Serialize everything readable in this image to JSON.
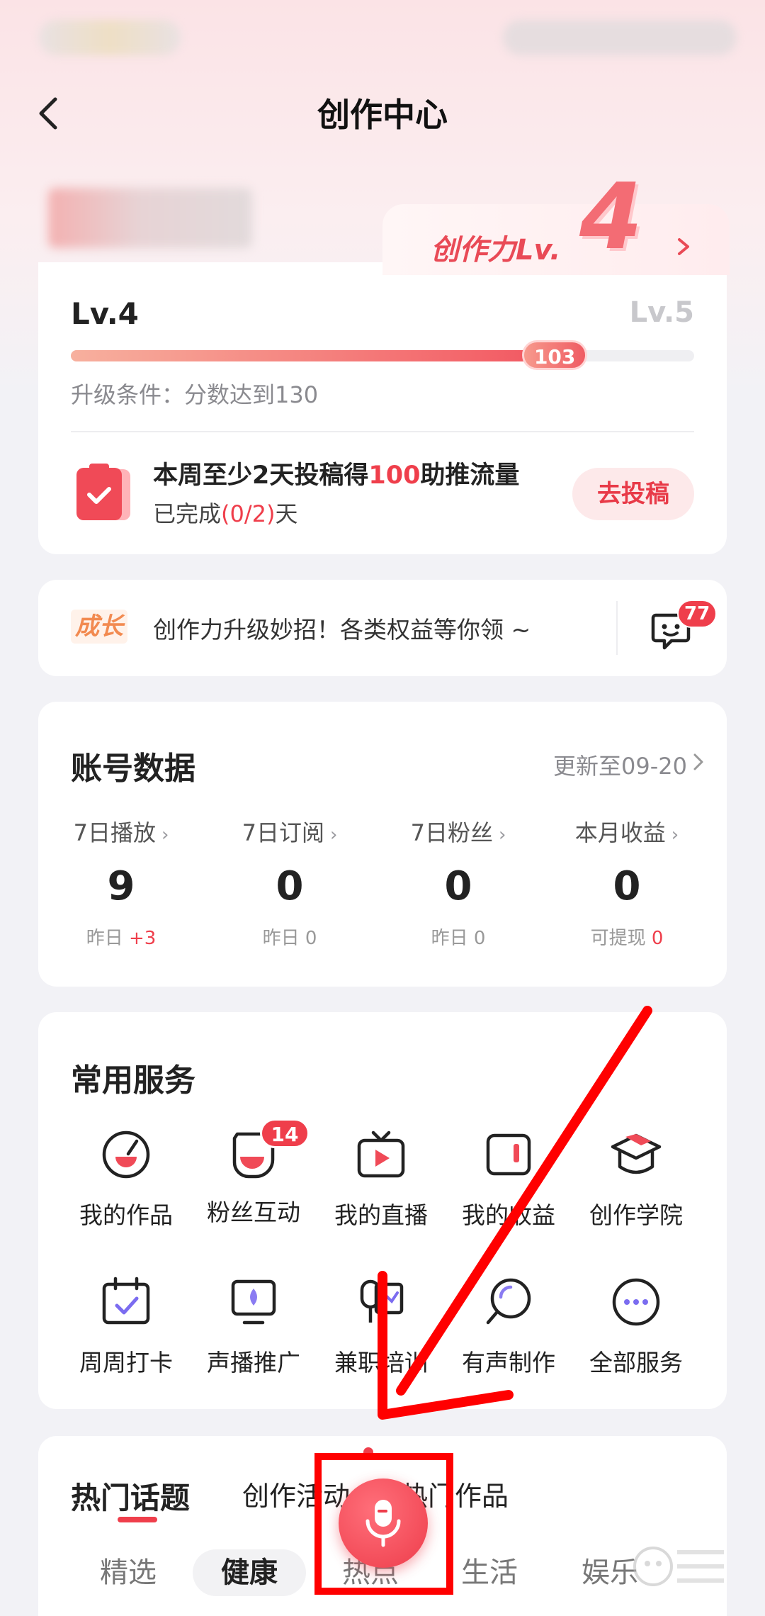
{
  "header": {
    "title": "创作中心"
  },
  "level_tab": {
    "label": "创作力Lv.",
    "level": "4"
  },
  "level_card": {
    "current_level": "Lv.4",
    "next_level": "Lv.5",
    "progress_score": "103",
    "progress_fraction": 0.792,
    "upgrade_condition": "升级条件：分数达到130",
    "task": {
      "title_prefix": "本周至少2天投稿得",
      "title_highlight": "100",
      "title_suffix": "助推流量",
      "sub_prefix": "已完成",
      "sub_highlight": "(0/2)",
      "sub_suffix": "天",
      "button": "去投稿"
    }
  },
  "growth_bar": {
    "badge": "成长",
    "text": "创作力升级妙招！各类权益等你领 ~",
    "message_count": "77"
  },
  "account_data": {
    "title": "账号数据",
    "updated": "更新至09-20",
    "stats": [
      {
        "label": "7日播放",
        "value": "9",
        "sub_prefix": "昨日 ",
        "sub_highlight": "+3"
      },
      {
        "label": "7日订阅",
        "value": "0",
        "sub_prefix": "昨日 0",
        "sub_highlight": ""
      },
      {
        "label": "7日粉丝",
        "value": "0",
        "sub_prefix": "昨日 0",
        "sub_highlight": ""
      },
      {
        "label": "本月收益",
        "value": "0",
        "sub_prefix": "可提现 ",
        "sub_highlight": "0"
      }
    ]
  },
  "services": {
    "title": "常用服务",
    "items": [
      {
        "label": "我的作品",
        "icon": "works-icon"
      },
      {
        "label": "粉丝互动",
        "icon": "fans-chat-icon",
        "badge": "14"
      },
      {
        "label": "我的直播",
        "icon": "live-tv-icon"
      },
      {
        "label": "我的收益",
        "icon": "wallet-icon"
      },
      {
        "label": "创作学院",
        "icon": "academy-icon"
      },
      {
        "label": "周周打卡",
        "icon": "calendar-check-icon"
      },
      {
        "label": "声播推广",
        "icon": "promote-icon"
      },
      {
        "label": "兼职培训",
        "icon": "training-icon"
      },
      {
        "label": "有声制作",
        "icon": "audio-production-icon"
      },
      {
        "label": "全部服务",
        "icon": "more-icon"
      }
    ]
  },
  "topics": {
    "tabs": [
      "热门话题",
      "创作活动",
      "热门作品"
    ],
    "sub_tabs": [
      "精选",
      "健康",
      "热点",
      "生活",
      "娱乐"
    ]
  },
  "colors": {
    "accent": "#ef3e4b",
    "annotation": "#ff0000"
  }
}
